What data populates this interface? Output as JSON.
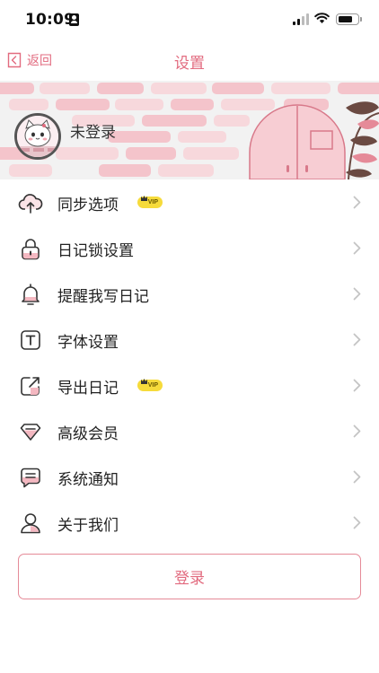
{
  "status_bar": {
    "time": "10:09",
    "icons": [
      "id-card-icon",
      "signal-icon",
      "wifi-icon",
      "battery-icon"
    ]
  },
  "nav": {
    "back_label": "返回",
    "title": "设置"
  },
  "profile": {
    "login_status": "未登录"
  },
  "menu": {
    "items": [
      {
        "label": "同步选项",
        "icon": "cloud-upload-icon",
        "vip": true,
        "vip_text": "VIP"
      },
      {
        "label": "日记锁设置",
        "icon": "lock-icon",
        "vip": false
      },
      {
        "label": "提醒我写日记",
        "icon": "bell-icon",
        "vip": false
      },
      {
        "label": "字体设置",
        "icon": "font-icon",
        "vip": false
      },
      {
        "label": "导出日记",
        "icon": "export-icon",
        "vip": true,
        "vip_text": "VIP"
      },
      {
        "label": "高级会员",
        "icon": "diamond-icon",
        "vip": false
      },
      {
        "label": "系统通知",
        "icon": "message-icon",
        "vip": false
      },
      {
        "label": "关于我们",
        "icon": "user-icon",
        "vip": false
      }
    ]
  },
  "login_button": "登录",
  "colors": {
    "accent": "#e26b7f",
    "accent_light": "#f4b8c1",
    "vip_yellow": "#f6db3b",
    "icon_stroke": "#333333"
  }
}
